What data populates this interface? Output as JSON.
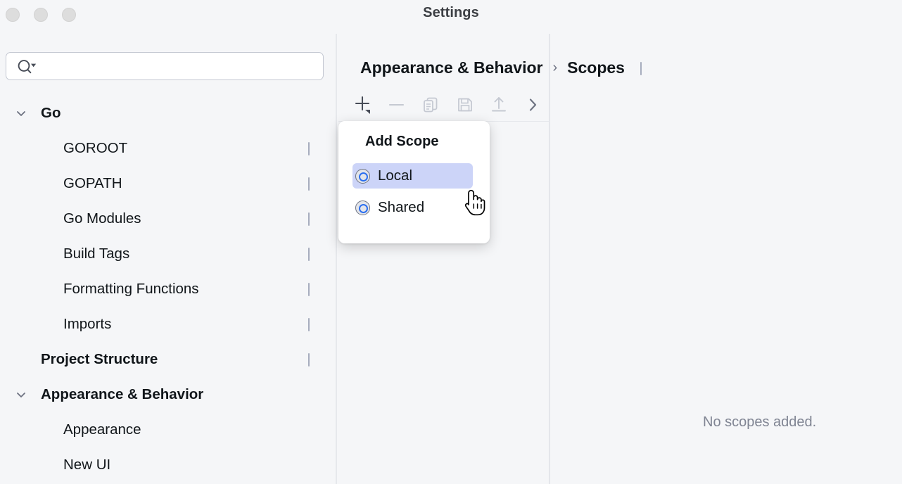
{
  "window": {
    "title": "Settings",
    "traffic_lights": [
      "close-button",
      "minimize-button",
      "zoom-button"
    ]
  },
  "search": {
    "value": "",
    "placeholder": "",
    "icon": "search-icon",
    "dropdown_icon": "chevron-down-icon"
  },
  "sidebar": {
    "items": [
      {
        "label": "Go",
        "level": "group",
        "expanded": true,
        "chevron": "chevron-down-icon",
        "trailing_icon": null
      },
      {
        "label": "GOROOT",
        "level": "child",
        "expanded": null,
        "chevron": null,
        "trailing_icon": "window-icon"
      },
      {
        "label": "GOPATH",
        "level": "child",
        "expanded": null,
        "chevron": null,
        "trailing_icon": "window-icon"
      },
      {
        "label": "Go Modules",
        "level": "child",
        "expanded": null,
        "chevron": null,
        "trailing_icon": "window-icon"
      },
      {
        "label": "Build Tags",
        "level": "child",
        "expanded": null,
        "chevron": null,
        "trailing_icon": "window-icon"
      },
      {
        "label": "Formatting Functions",
        "level": "child",
        "expanded": null,
        "chevron": null,
        "trailing_icon": "window-icon"
      },
      {
        "label": "Imports",
        "level": "child",
        "expanded": null,
        "chevron": null,
        "trailing_icon": "window-icon"
      },
      {
        "label": "Project Structure",
        "level": "leafbold",
        "expanded": null,
        "chevron": null,
        "trailing_icon": "window-icon"
      },
      {
        "label": "Appearance & Behavior",
        "level": "group",
        "expanded": true,
        "chevron": "chevron-down-icon",
        "trailing_icon": null
      },
      {
        "label": "Appearance",
        "level": "child",
        "expanded": null,
        "chevron": null,
        "trailing_icon": null
      },
      {
        "label": "New UI",
        "level": "child",
        "expanded": null,
        "chevron": null,
        "trailing_icon": null
      }
    ]
  },
  "breadcrumb": {
    "root": "Appearance & Behavior",
    "separator": "›",
    "current": "Scopes",
    "icon": "window-icon"
  },
  "toolbar": {
    "buttons": [
      {
        "name": "add-scope-button",
        "icon": "plus-icon",
        "enabled": true,
        "has_dropdown": true
      },
      {
        "name": "remove-scope-button",
        "icon": "minus-icon",
        "enabled": false,
        "has_dropdown": false
      },
      {
        "name": "duplicate-scope-button",
        "icon": "copy-icon",
        "enabled": false,
        "has_dropdown": false
      },
      {
        "name": "save-scope-button",
        "icon": "save-icon",
        "enabled": false,
        "has_dropdown": false
      },
      {
        "name": "share-scope-button",
        "icon": "upload-icon",
        "enabled": false,
        "has_dropdown": false
      },
      {
        "name": "expand-button",
        "icon": "chevron-right-icon",
        "enabled": true,
        "has_dropdown": false
      }
    ]
  },
  "main": {
    "empty_message": "No scopes added."
  },
  "popup": {
    "title": "Add Scope",
    "items": [
      {
        "label": "Local",
        "icon": "scope-local-icon",
        "selected": true
      },
      {
        "label": "Shared",
        "icon": "scope-shared-icon",
        "selected": false
      }
    ]
  },
  "cursor": {
    "type": "pointing-hand-cursor"
  },
  "colors": {
    "background": "#f5f6f8",
    "panel_white": "#ffffff",
    "text_primary": "#11161a",
    "text_muted": "#808593",
    "title_gray": "#3c3f44",
    "selection_blue": "#ccd4f8",
    "accent_blue": "#2b6ff0",
    "icon_gray": "#a7adbe",
    "divider": "#e6e8ec"
  }
}
